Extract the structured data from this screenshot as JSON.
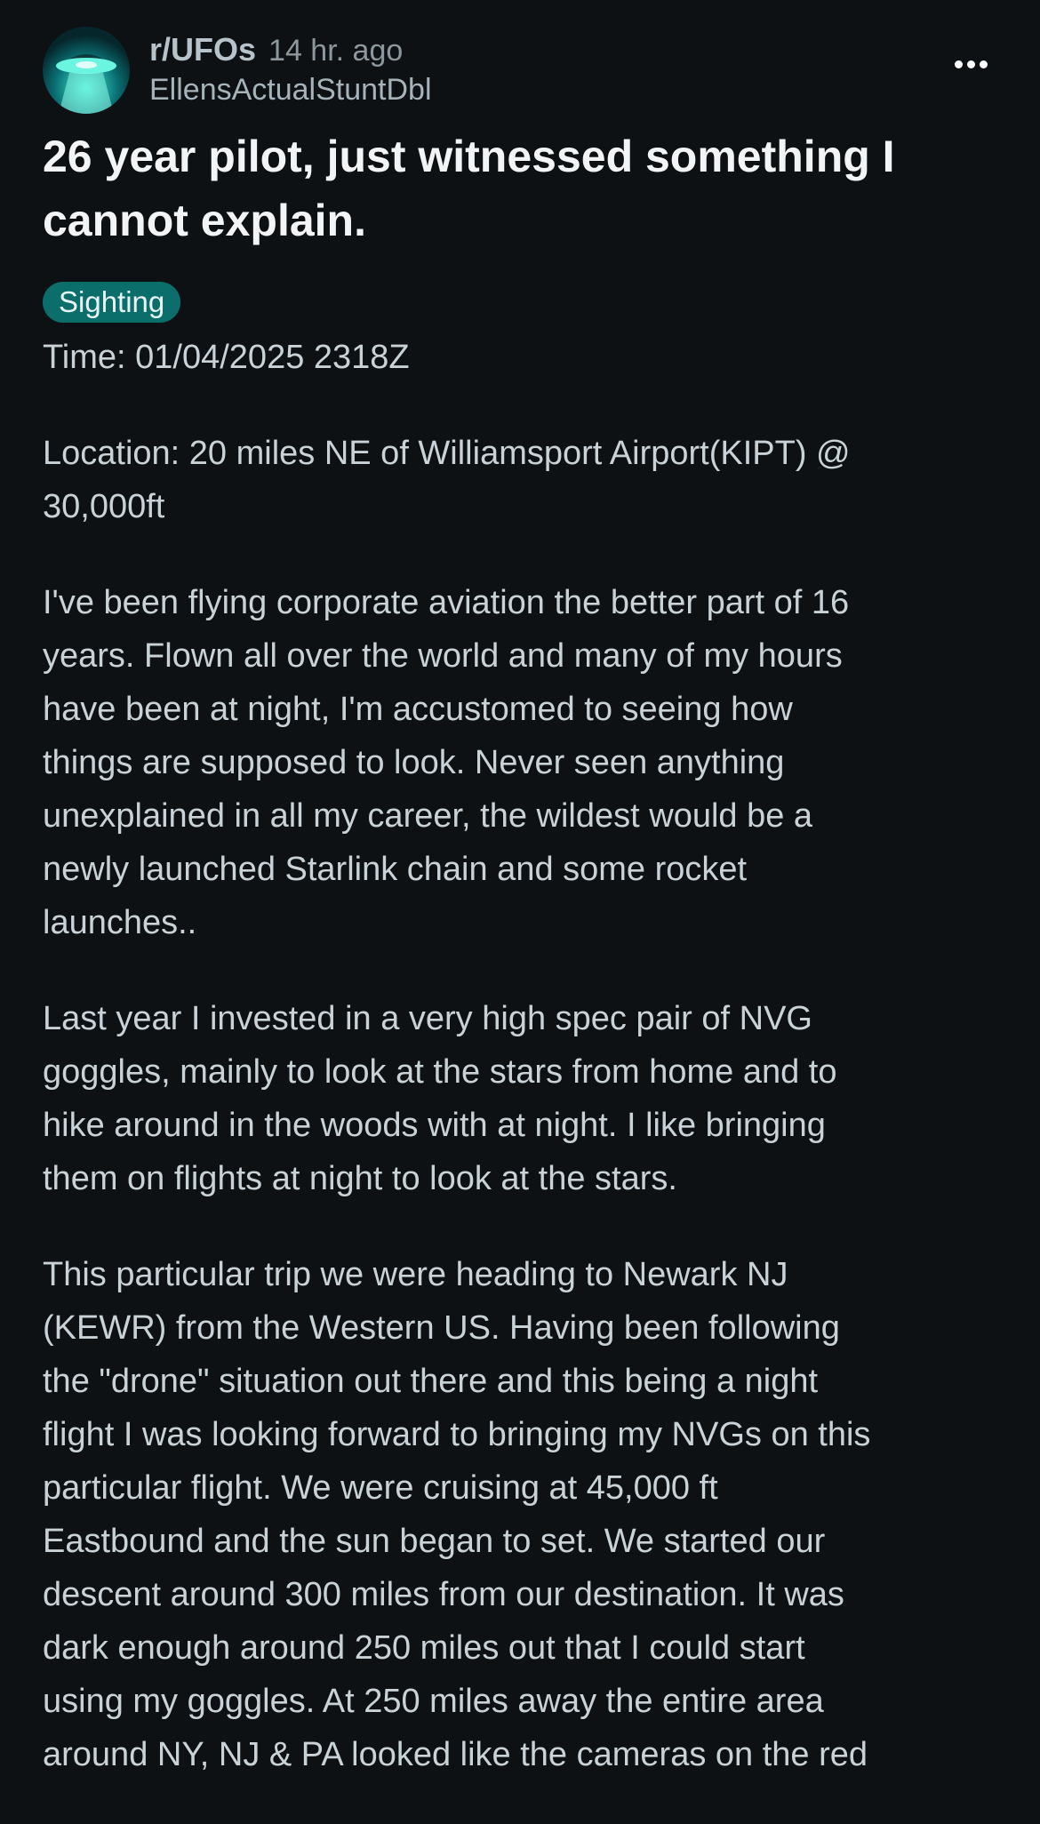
{
  "header": {
    "subreddit": "r/UFOs",
    "time_ago": "14 hr. ago",
    "author": "EllensActualStuntDbl",
    "more_icon": "more-horizontal-icon",
    "avatar_icon": "ufo-icon"
  },
  "post": {
    "title": "26 year pilot, just witnessed something I cannot explain.",
    "flair": "Sighting",
    "paragraphs": [
      "Time: 01/04/2025 2318Z",
      "Location: 20 miles NE of Williamsport Airport(KIPT) @\n30,000ft",
      "I've been flying corporate aviation the better part of 16\nyears. Flown all over the world and many of my hours\nhave been at night, I'm accustomed to seeing how\nthings are supposed to look. Never seen anything\nunexplained in all my career, the wildest would be a\nnewly launched Starlink chain and some rocket\nlaunches..",
      "Last year I invested in a very high spec pair of NVG\ngoggles, mainly to look at the stars from home and to\nhike around in the woods with at night. I like bringing\nthem on flights at night to look at the stars.",
      "This particular trip we were heading to Newark NJ\n(KEWR) from the Western US. Having been following\nthe \"drone\" situation out there and this being a night\nflight I was looking forward to bringing my NVGs on this\nparticular flight. We were cruising at 45,000 ft\nEastbound and the sun began to set. We started our\ndescent around 300 miles from our destination. It was\ndark enough around 250 miles out that I could start\nusing my goggles. At 250 miles away the entire area\naround NY, NJ & PA looked like the cameras on the red"
    ]
  },
  "colors": {
    "background": "#0e1113",
    "flair_bg": "#0b6e6b",
    "title": "#f2f4f5",
    "body_text": "#c8d2d7"
  }
}
